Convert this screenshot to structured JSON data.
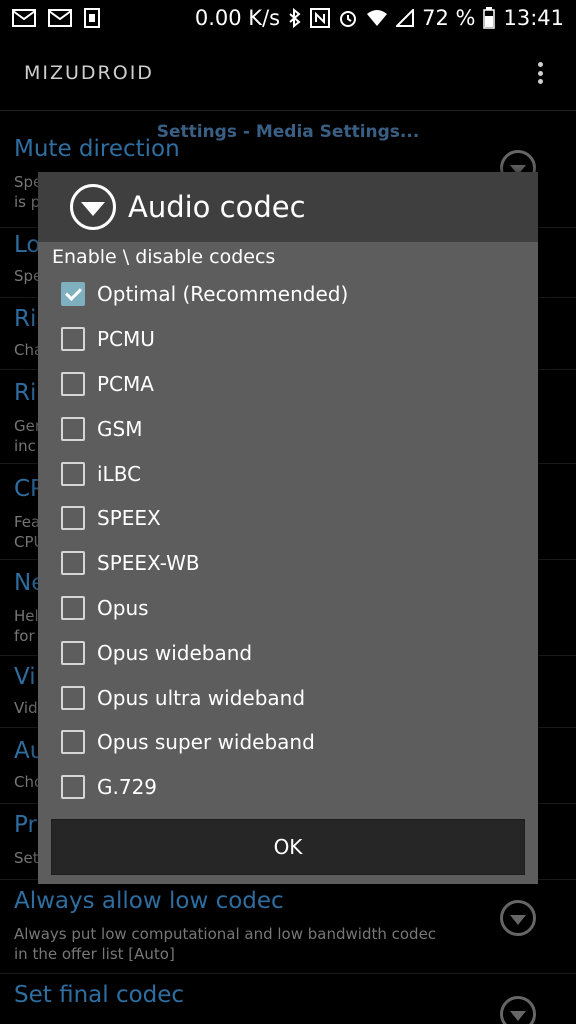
{
  "status_bar": {
    "speed": "0.00 K/s",
    "battery": "72 %",
    "time": "13:41",
    "left_icons": [
      "mail-icon",
      "mail-icon",
      "sim-icon"
    ],
    "right_icons": [
      "bluetooth-icon",
      "nfc-icon",
      "alarm-icon",
      "wifi-icon",
      "signal-icon",
      "battery-icon"
    ]
  },
  "app": {
    "logo": "MIZUDROID"
  },
  "breadcrumb": "Settings - Media Settings...",
  "background_items": [
    {
      "title": "Mute direction",
      "sub1": "Spe",
      "sub2": "is p"
    },
    {
      "title": "Lo",
      "sub1": "Spe",
      "sub2": ""
    },
    {
      "title": "Ri",
      "sub1": "Cha",
      "sub2": ""
    },
    {
      "title": "Ri",
      "sub1": "Gen",
      "sub2": "inc"
    },
    {
      "title": "CP",
      "sub1": "Fea",
      "sub2": "CPU"
    },
    {
      "title": "Ne",
      "sub1": "Hel",
      "sub2": "for"
    },
    {
      "title": "Vi",
      "sub1": "Vid",
      "sub2": ""
    },
    {
      "title": "Au",
      "sub1": "Cho",
      "sub2": ""
    },
    {
      "title": "Pr",
      "sub1": "Set",
      "sub2": ""
    },
    {
      "title": "Always allow low codec",
      "sub1": "Always put low computational and low bandwidth codec",
      "sub2": "in the offer list [Auto]"
    },
    {
      "title": "Set final codec",
      "sub1": "",
      "sub2": ""
    }
  ],
  "dialog": {
    "title": "Audio codec",
    "subtitle": "Enable \\ disable codecs",
    "codecs": [
      {
        "label": "Optimal (Recommended)",
        "checked": true
      },
      {
        "label": "PCMU",
        "checked": false
      },
      {
        "label": "PCMA",
        "checked": false
      },
      {
        "label": "GSM",
        "checked": false
      },
      {
        "label": "iLBC",
        "checked": false
      },
      {
        "label": "SPEEX",
        "checked": false
      },
      {
        "label": "SPEEX-WB",
        "checked": false
      },
      {
        "label": "Opus",
        "checked": false
      },
      {
        "label": "Opus wideband",
        "checked": false
      },
      {
        "label": "Opus ultra wideband",
        "checked": false
      },
      {
        "label": "Opus super wideband",
        "checked": false
      },
      {
        "label": "G.729",
        "checked": false
      }
    ],
    "ok_label": "OK"
  },
  "colors": {
    "accent": "#2f6ea0",
    "dialog_bg": "#5d5d5d",
    "dialog_header": "#3f3f3f",
    "check": "#7fb0c0"
  }
}
